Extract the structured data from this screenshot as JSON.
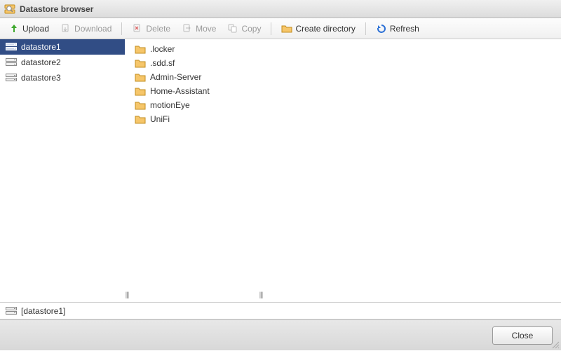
{
  "window": {
    "title": "Datastore browser"
  },
  "toolbar": {
    "upload": "Upload",
    "download": "Download",
    "delete": "Delete",
    "move": "Move",
    "copy": "Copy",
    "create_dir": "Create directory",
    "refresh": "Refresh"
  },
  "datastores": {
    "selected_index": 0,
    "items": [
      {
        "name": "datastore1"
      },
      {
        "name": "datastore2"
      },
      {
        "name": "datastore3"
      }
    ]
  },
  "folders": {
    "items": [
      {
        "name": ".locker"
      },
      {
        "name": ".sdd.sf"
      },
      {
        "name": "Admin-Server"
      },
      {
        "name": "Home-Assistant"
      },
      {
        "name": "motionEye"
      },
      {
        "name": "UniFi"
      }
    ]
  },
  "path": {
    "text": "[datastore1]"
  },
  "buttons": {
    "close": "Close"
  }
}
